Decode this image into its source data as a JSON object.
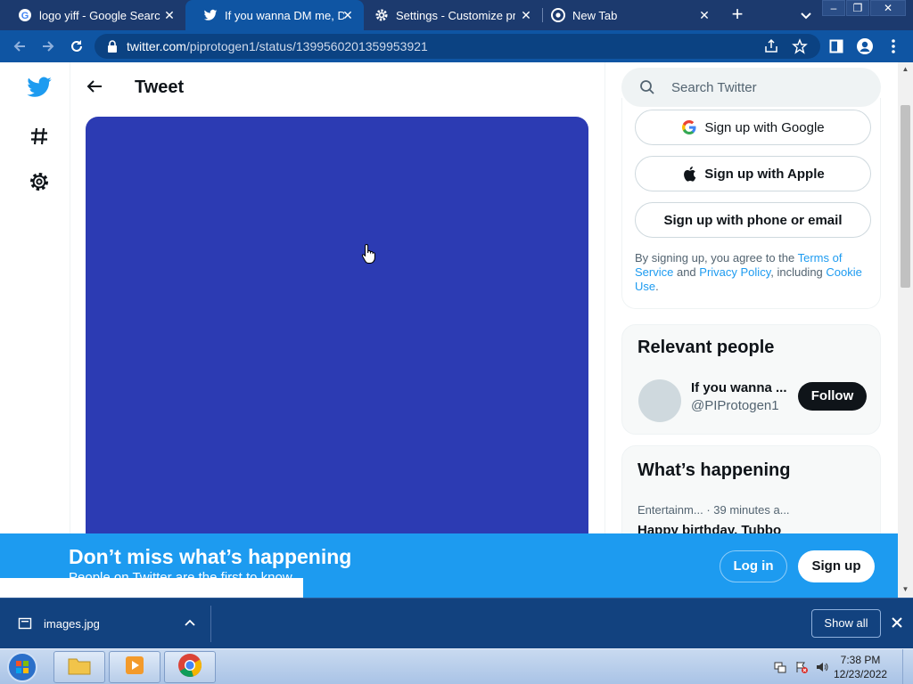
{
  "browser": {
    "tabs": [
      {
        "title": "logo yiff - Google Search",
        "icon": "google-icon",
        "active": false
      },
      {
        "title": "If you wanna DM me, DM",
        "icon": "twitter-icon",
        "active": true
      },
      {
        "title": "Settings - Customize prof",
        "icon": "gear-icon",
        "active": false
      },
      {
        "title": "New Tab",
        "icon": "chrome-icon",
        "active": false
      }
    ],
    "url_host": "twitter.com",
    "url_path": "/piprotogen1/status/1399560201359953921"
  },
  "tweet": {
    "title": "Tweet",
    "media_color": "#2c3bb3"
  },
  "sidebar": {
    "search_placeholder": "Search Twitter",
    "signup_google": "Sign up with Google",
    "signup_apple": "Sign up with Apple",
    "signup_phone": "Sign up with phone or email",
    "legal_prefix": "By signing up, you agree to the ",
    "legal_terms": "Terms of Service",
    "legal_and": " and ",
    "legal_privacy": "Privacy Policy",
    "legal_including": ", including ",
    "legal_cookie": "Cookie Use",
    "legal_end": "."
  },
  "relevant_people": {
    "title": "Relevant people",
    "name": "If you wanna ...",
    "handle": "@PIProtogen1",
    "follow_label": "Follow"
  },
  "happening": {
    "title": "What’s happening",
    "trend_category": "Entertainm...",
    "trend_time": "· 39 minutes a...",
    "trend_title": "Happy birthday, Tubbo"
  },
  "banner": {
    "title": "Don’t miss what’s happening",
    "subtitle": "People on Twitter are the first to know.",
    "login_label": "Log in",
    "signup_label": "Sign up"
  },
  "downloads": {
    "filename": "images.jpg",
    "show_all_label": "Show all"
  },
  "taskbar": {
    "time": "7:38 PM",
    "date": "12/23/2022"
  },
  "colors": {
    "twitter_blue": "#1d9bf0",
    "chrome_frame": "#1c3a6e",
    "chrome_toolbar": "#0f55a3"
  }
}
